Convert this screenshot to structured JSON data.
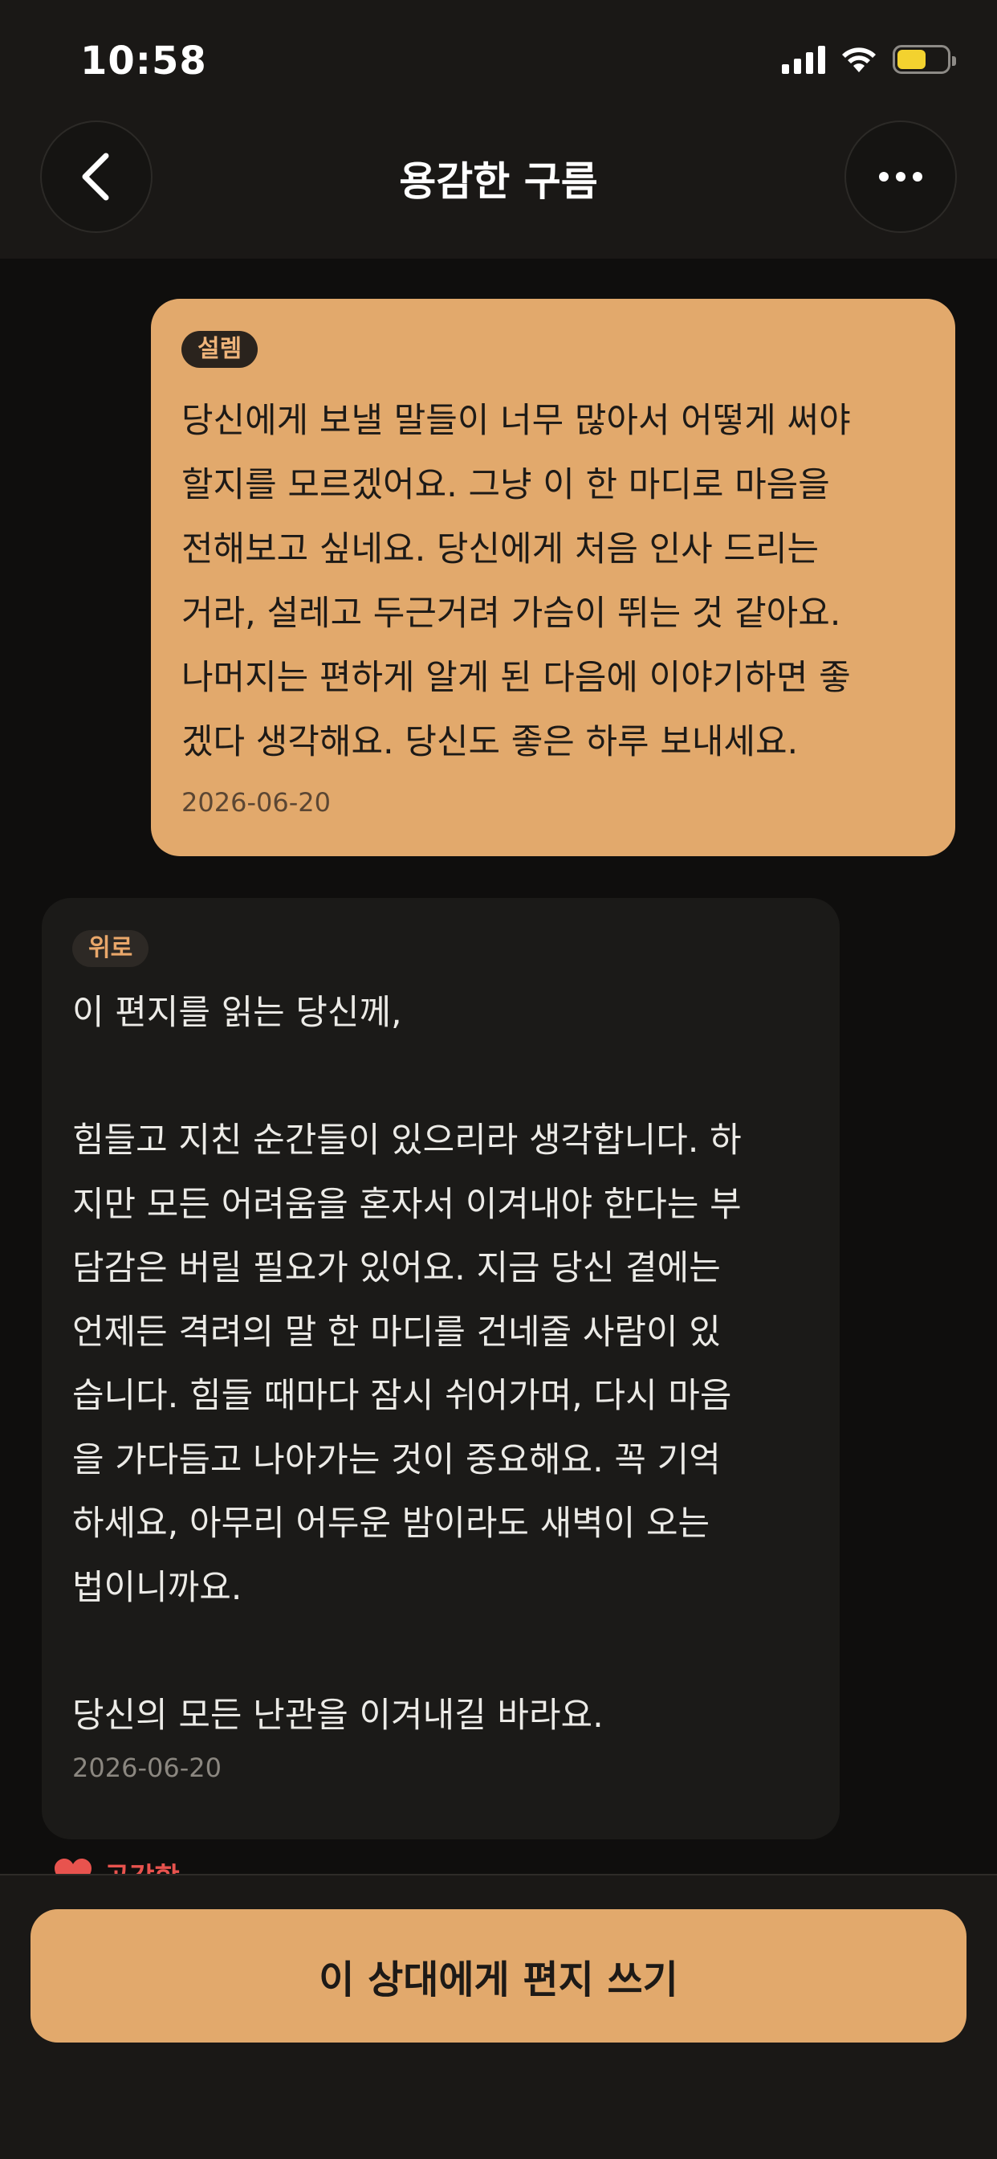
{
  "status_bar": {
    "time": "10:58"
  },
  "header": {
    "title": "용감한 구름"
  },
  "letters": [
    {
      "tag": "설렘",
      "body": "당신에게 보낼 말들이 너무 많아서 어떻게 써야\n할지를 모르겠어요. 그냥 이 한 마디로 마음을\n전해보고 싶네요. 당신에게 처음 인사 드리는\n거라, 설레고 두근거려 가슴이 뛰는 것 같아요.\n나머지는 편하게 알게 된 다음에 이야기하면 좋\n겠다 생각해요. 당신도 좋은 하루 보내세요.",
      "date": "2026-06-20"
    },
    {
      "tag": "위로",
      "body": "이 편지를 읽는 당신께,\n\n힘들고 지친 순간들이 있으리라 생각합니다. 하\n지만 모든 어려움을 혼자서 이겨내야 한다는 부\n담감은 버릴 필요가 있어요. 지금 당신 곁에는\n언제든 격려의 말 한 마디를 건네줄 사람이 있\n습니다. 힘들 때마다 잠시 쉬어가며, 다시 마음\n을 가다듬고 나아가는 것이 중요해요. 꼭 기억\n하세요, 아무리 어두운 밤이라도 새벽이 오는\n법이니까요.\n\n당신의 모든 난관을 이겨내길 바라요.",
      "date": "2026-06-20"
    }
  ],
  "like": {
    "label": "공감함"
  },
  "bottom": {
    "write_label": "이 상대에게 편지 쓰기"
  },
  "colors": {
    "accent": "#e2a96c",
    "background": "#0f0e0d",
    "like": "#e8534e"
  }
}
